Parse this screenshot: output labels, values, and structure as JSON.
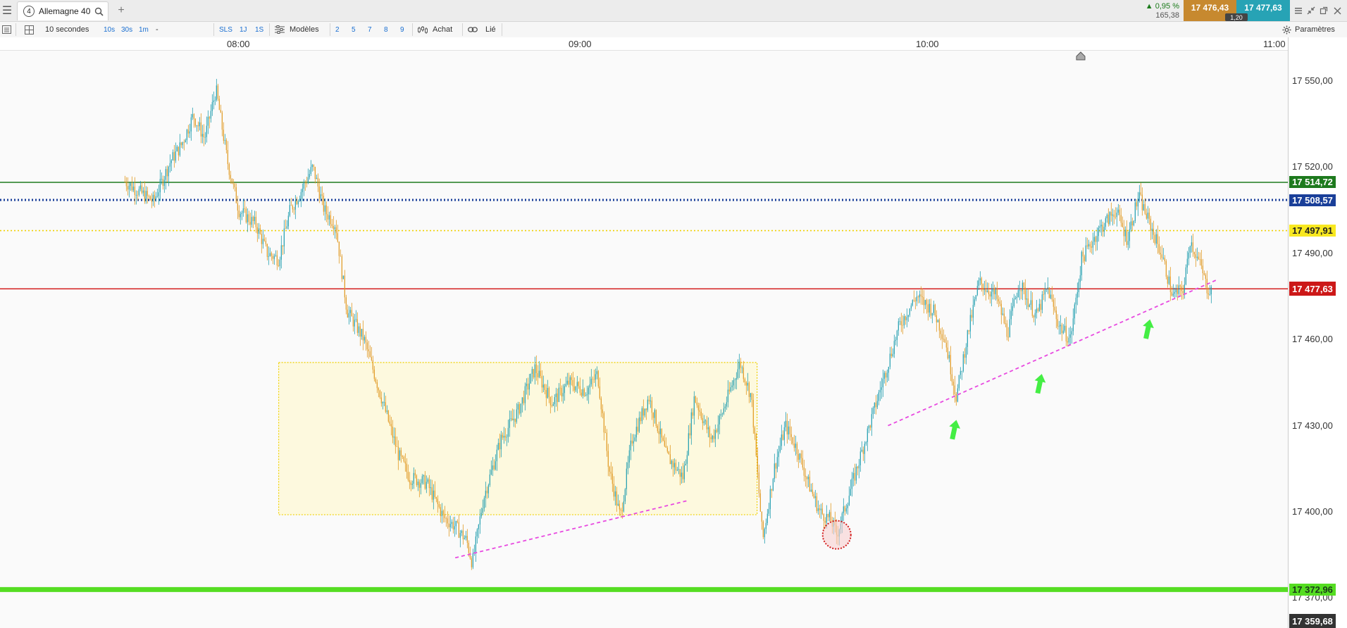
{
  "window": {
    "tab_number": "4",
    "tab_title": "Allemagne 40",
    "change_pct": "▲ 0,95 %",
    "change_pts": "165,38",
    "bid": "17 476,43",
    "ask": "17 477,63",
    "spread": "1,20"
  },
  "toolbar": {
    "period": "10 secondes",
    "tf_10s": "10s",
    "tf_30s": "30s",
    "tf_1m": "1m",
    "tf_more": "-",
    "sls": "SLS",
    "one_j": "1J",
    "one_s": "1S",
    "models": "Modèles",
    "n2": "2",
    "n5": "5",
    "n7": "7",
    "n8": "8",
    "n9": "9",
    "buy": "Achat",
    "linked": "Lié",
    "settings": "Paramètres"
  },
  "colors": {
    "up": "#26a0b1",
    "down": "#e19a26",
    "resistance": "#1e7a1e",
    "pivot": "#1a3f99",
    "yellow": "#f0d000",
    "current": "#d42020",
    "support": "#55dd22",
    "trend": "#e84ae0",
    "arrow": "#44ee44"
  },
  "chart_data": {
    "type": "candlestick",
    "instrument": "Allemagne 40",
    "timeframe": "10 secondes",
    "x_ticks": [
      "08:00",
      "09:00",
      "10:00",
      "11:00"
    ],
    "y_ticks": [
      "17 550,00",
      "17 520,00",
      "17 490,00",
      "17 460,00",
      "17 430,00",
      "17 400,00",
      "17 370,00"
    ],
    "ylim": [
      17359.68,
      17560.0
    ],
    "bottom_value": "17 359,68",
    "levels": [
      {
        "label": "17 514,72",
        "value": 17514.72,
        "style": "solid",
        "color": "#1e7a1e"
      },
      {
        "label": "17 508,57",
        "value": 17508.57,
        "style": "dotted",
        "color": "#1a3f99"
      },
      {
        "label": "17 497,91",
        "value": 17497.91,
        "style": "dotted",
        "color": "#f0d000"
      },
      {
        "label": "17 477,63",
        "value": 17477.63,
        "style": "solid",
        "color": "#d42020"
      },
      {
        "label": "17 372,96",
        "value": 17372.96,
        "style": "thick",
        "color": "#55dd22"
      }
    ],
    "price_path": [
      [
        "07:40",
        17515
      ],
      [
        "07:45",
        17508
      ],
      [
        "07:48",
        17522
      ],
      [
        "07:50",
        17528
      ],
      [
        "07:52",
        17538
      ],
      [
        "07:54",
        17530
      ],
      [
        "07:56",
        17547
      ],
      [
        "07:58",
        17522
      ],
      [
        "08:00",
        17505
      ],
      [
        "08:03",
        17500
      ],
      [
        "08:05",
        17490
      ],
      [
        "08:07",
        17488
      ],
      [
        "08:09",
        17505
      ],
      [
        "08:11",
        17512
      ],
      [
        "08:13",
        17520
      ],
      [
        "08:15",
        17505
      ],
      [
        "08:17",
        17500
      ],
      [
        "08:19",
        17470
      ],
      [
        "08:22",
        17460
      ],
      [
        "08:25",
        17440
      ],
      [
        "08:28",
        17420
      ],
      [
        "08:30",
        17412
      ],
      [
        "08:33",
        17410
      ],
      [
        "08:36",
        17398
      ],
      [
        "08:38",
        17395
      ],
      [
        "08:40",
        17390
      ],
      [
        "08:41",
        17382
      ],
      [
        "08:43",
        17405
      ],
      [
        "08:46",
        17425
      ],
      [
        "08:49",
        17435
      ],
      [
        "08:52",
        17450
      ],
      [
        "08:55",
        17438
      ],
      [
        "08:58",
        17445
      ],
      [
        "09:01",
        17442
      ],
      [
        "09:03",
        17448
      ],
      [
        "09:05",
        17415
      ],
      [
        "09:07",
        17398
      ],
      [
        "09:09",
        17425
      ],
      [
        "09:12",
        17440
      ],
      [
        "09:15",
        17420
      ],
      [
        "09:18",
        17412
      ],
      [
        "09:20",
        17440
      ],
      [
        "09:23",
        17425
      ],
      [
        "09:25",
        17435
      ],
      [
        "09:28",
        17452
      ],
      [
        "09:30",
        17440
      ],
      [
        "09:32",
        17390
      ],
      [
        "09:34",
        17415
      ],
      [
        "09:36",
        17430
      ],
      [
        "09:38",
        17422
      ],
      [
        "09:40",
        17410
      ],
      [
        "09:42",
        17400
      ],
      [
        "09:44",
        17397
      ],
      [
        "09:45",
        17392
      ],
      [
        "09:47",
        17405
      ],
      [
        "09:50",
        17425
      ],
      [
        "09:53",
        17445
      ],
      [
        "09:56",
        17465
      ],
      [
        "09:59",
        17475
      ],
      [
        "10:02",
        17470
      ],
      [
        "10:04",
        17460
      ],
      [
        "10:06",
        17440
      ],
      [
        "10:08",
        17462
      ],
      [
        "10:10",
        17480
      ],
      [
        "10:13",
        17475
      ],
      [
        "10:15",
        17462
      ],
      [
        "10:17",
        17480
      ],
      [
        "10:20",
        17468
      ],
      [
        "10:22",
        17478
      ],
      [
        "10:24",
        17465
      ],
      [
        "10:26",
        17460
      ],
      [
        "10:28",
        17488
      ],
      [
        "10:31",
        17498
      ],
      [
        "10:34",
        17505
      ],
      [
        "10:36",
        17495
      ],
      [
        "10:38",
        17510
      ],
      [
        "10:40",
        17500
      ],
      [
        "10:42",
        17490
      ],
      [
        "10:44",
        17475
      ],
      [
        "10:46",
        17478
      ],
      [
        "10:47",
        17495
      ],
      [
        "10:49",
        17485
      ],
      [
        "10:50",
        17478
      ],
      [
        "10:51",
        17477
      ]
    ],
    "trendlines": [
      {
        "from": [
          "08:38",
          17384
        ],
        "to": [
          "09:19",
          17404
        ]
      },
      {
        "from": [
          "09:54",
          17430
        ],
        "to": [
          "10:52",
          17481
        ]
      }
    ],
    "range_box": {
      "from": [
        "08:07",
        17452
      ],
      "to": [
        "09:31",
        17399
      ]
    },
    "circle_marker": [
      "09:45",
      17392
    ],
    "arrows": [
      [
        "10:06",
        17432
      ],
      [
        "10:21",
        17448
      ],
      [
        "10:40",
        17467
      ]
    ]
  }
}
